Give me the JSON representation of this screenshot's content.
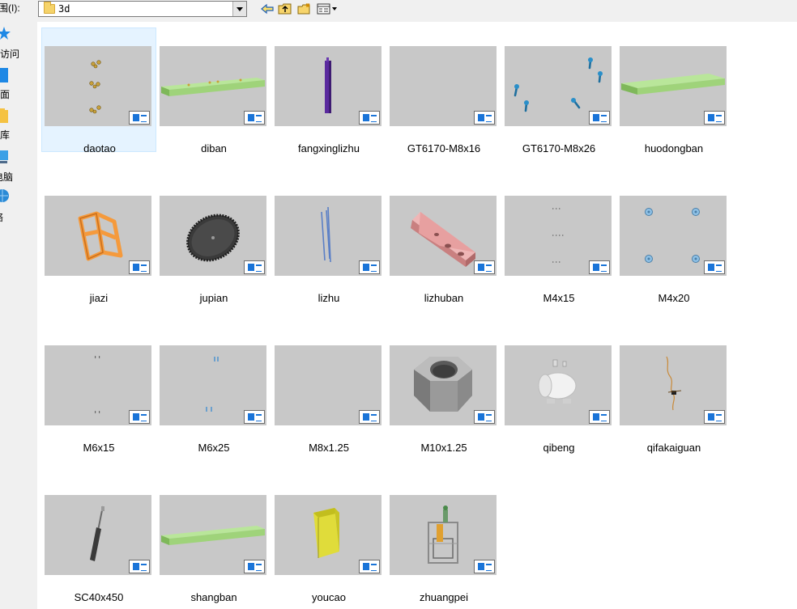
{
  "toolbar": {
    "look_in_label": "范围(I):",
    "location_value": "3d",
    "back_icon": "back-arrow-icon",
    "up_icon": "up-folder-icon",
    "new_folder_icon": "new-folder-icon",
    "view_menu_icon": "view-menu-icon"
  },
  "nav": {
    "items": [
      {
        "label": "访问",
        "icon": "star-icon"
      },
      {
        "label": "面",
        "icon": "desktop-icon"
      },
      {
        "label": "库",
        "icon": "library-icon"
      },
      {
        "label": "电脑",
        "icon": "computer-icon"
      },
      {
        "label": "络",
        "icon": "network-icon"
      }
    ]
  },
  "files": [
    {
      "name": "daotao",
      "selected": true
    },
    {
      "name": "diban"
    },
    {
      "name": "fangxinglizhu"
    },
    {
      "name": "GT6170-M8x16"
    },
    {
      "name": "GT6170-M8x26"
    },
    {
      "name": "huodongban"
    },
    {
      "name": "jiazi"
    },
    {
      "name": "jupian"
    },
    {
      "name": "lizhu"
    },
    {
      "name": "lizhuban"
    },
    {
      "name": "M4x15"
    },
    {
      "name": "M4x20"
    },
    {
      "name": "M6x15"
    },
    {
      "name": "M6x25"
    },
    {
      "name": "M8x1.25"
    },
    {
      "name": "M10x1.25"
    },
    {
      "name": "qibeng"
    },
    {
      "name": "qifakaiguan"
    },
    {
      "name": "SC40x450"
    },
    {
      "name": "shangban"
    },
    {
      "name": "youcao"
    },
    {
      "name": "zhuangpei"
    }
  ],
  "colors": {
    "selection_bg": "#e5f3ff",
    "thumb_bg": "#c8c8c8",
    "badge_blue": "#1a74d8",
    "plate_green": "#9fd37a",
    "post_purple": "#5a2a9e",
    "frame_orange": "#f59a3c",
    "bracket_pink": "#e7a0a0",
    "tank_yellow": "#e0dc3a"
  }
}
